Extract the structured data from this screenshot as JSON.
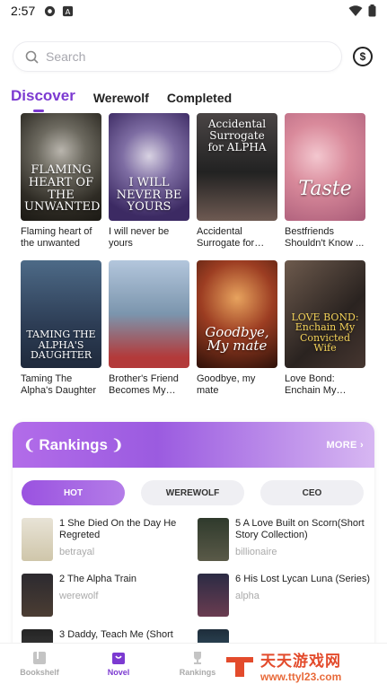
{
  "status_bar": {
    "time": "2:57"
  },
  "search": {
    "placeholder": "Search"
  },
  "wallet": {
    "icon": "dollar-coin-icon",
    "symbol": "$"
  },
  "tabs": [
    {
      "label": "Discover",
      "active": true
    },
    {
      "label": "Werewolf",
      "active": false
    },
    {
      "label": "Completed",
      "active": false
    }
  ],
  "books": [
    {
      "title": "Flaming heart of the unwanted",
      "cover_top": "",
      "cover_text": "FLAMING HEART OF THE UNWANTED"
    },
    {
      "title": "I will never be yours",
      "cover_top": "",
      "cover_text": "I WILL NEVER BE YOURS"
    },
    {
      "title": "Accidental Surrogate for Alp...",
      "cover_top": "Accidental Surrogate for ALPHA",
      "cover_text": ""
    },
    {
      "title": "Bestfriends Shouldn't Know ...",
      "cover_top": "",
      "cover_text": "Taste"
    },
    {
      "title": "Taming The Alpha's Daughter",
      "cover_top": "",
      "cover_text": "TAMING THE ALPHA'S DAUGHTER"
    },
    {
      "title": "Brother's Friend Becomes My Bab...",
      "cover_top": "",
      "cover_text": ""
    },
    {
      "title": "Goodbye, my mate",
      "cover_top": "",
      "cover_text": "Goodbye, My mate"
    },
    {
      "title": "Love Bond: Enchain My Conv...",
      "cover_top": "",
      "cover_text": "LOVE BOND: Enchain My Convicted Wife"
    }
  ],
  "rankings": {
    "title": "Rankings",
    "more_label": "MORE",
    "tabs": [
      {
        "label": "HOT",
        "active": true
      },
      {
        "label": "WEREWOLF",
        "active": false
      },
      {
        "label": "CEO",
        "active": false
      }
    ],
    "items": [
      {
        "rank": "1",
        "title": "She Died On the Day He Regreted",
        "tag": "betrayal"
      },
      {
        "rank": "5",
        "title": "A Love Built on Scorn(Short Story Collection)",
        "tag": "billionaire"
      },
      {
        "rank": "2",
        "title": "The Alpha Train",
        "tag": "werewolf"
      },
      {
        "rank": "6",
        "title": "His Lost Lycan Luna (Series)",
        "tag": "alpha"
      },
      {
        "rank": "3",
        "title": "Daddy, Teach Me (Short",
        "tag": ""
      },
      {
        "rank": "",
        "title": "",
        "tag": ""
      }
    ]
  },
  "bottom_nav": [
    {
      "label": "Bookshelf",
      "icon": "bookshelf-icon",
      "active": false
    },
    {
      "label": "Novel",
      "icon": "novel-bag-icon",
      "active": true
    },
    {
      "label": "Rankings",
      "icon": "trophy-icon",
      "active": false
    }
  ],
  "watermark": {
    "name": "天天游戏网",
    "url": "www.ttyl23.com"
  },
  "colors": {
    "accent": "#7c3ad1",
    "rank_gradient_start": "#b26ce9"
  }
}
